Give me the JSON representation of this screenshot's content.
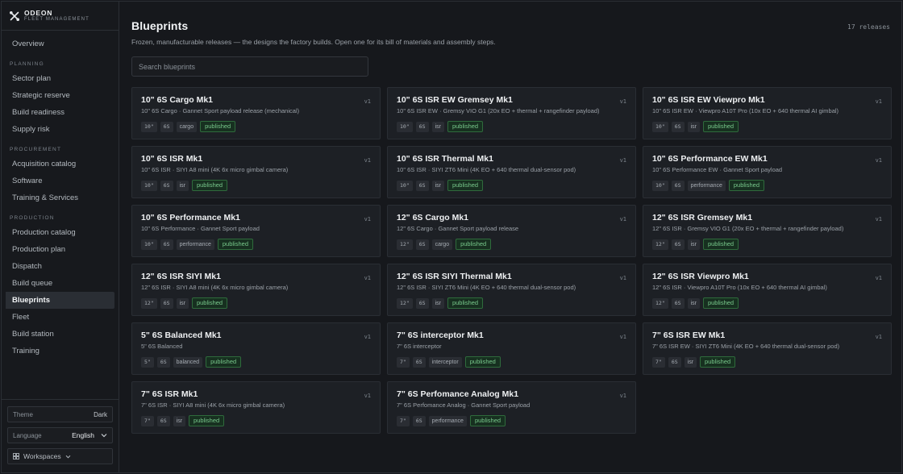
{
  "brand": {
    "name": "ODEON",
    "subtitle": "FLEET MANAGEMENT",
    "logo_icon": "crossed-tools-icon"
  },
  "sidebar": {
    "top_items": [
      {
        "label": "Overview"
      }
    ],
    "sections": [
      {
        "title": "PLANNING",
        "items": [
          {
            "label": "Sector plan"
          },
          {
            "label": "Strategic reserve"
          },
          {
            "label": "Build readiness"
          },
          {
            "label": "Supply risk"
          }
        ]
      },
      {
        "title": "PROCUREMENT",
        "items": [
          {
            "label": "Acquisition catalog"
          },
          {
            "label": "Software"
          },
          {
            "label": "Training & Services"
          }
        ]
      },
      {
        "title": "PRODUCTION",
        "items": [
          {
            "label": "Production catalog"
          },
          {
            "label": "Production plan"
          },
          {
            "label": "Dispatch"
          },
          {
            "label": "Build queue"
          },
          {
            "label": "Blueprints",
            "active": true
          },
          {
            "label": "Fleet"
          },
          {
            "label": "Build station"
          },
          {
            "label": "Training"
          }
        ]
      }
    ],
    "theme": {
      "label": "Theme",
      "value": "Dark"
    },
    "language": {
      "label": "Language",
      "value": "English"
    },
    "workspaces": {
      "label": "Workspaces",
      "icon": "grid-icon"
    }
  },
  "header": {
    "title": "Blueprints",
    "count": "17 releases",
    "subtitle": "Frozen, manufacturable releases — the designs the factory builds. Open one for its bill of materials and assembly steps."
  },
  "search": {
    "placeholder": "Search blueprints"
  },
  "colors": {
    "accent_status": "#79c98c",
    "status_bg": "#173020",
    "background": "#16181c",
    "card": "#1d2025"
  },
  "blueprints": [
    {
      "title": "10\" 6S Cargo Mk1",
      "version": "v1",
      "description": "10\" 6S Cargo · Gannet Sport payload release (mechanical)",
      "tags": [
        "10\"",
        "6S",
        "cargo"
      ],
      "status": "published"
    },
    {
      "title": "10\" 6S ISR EW Gremsey Mk1",
      "version": "v1",
      "description": "10\" 6S ISR EW · Gremsy VIO G1 (20x EO + thermal + rangefinder payload)",
      "tags": [
        "10\"",
        "6S",
        "isr"
      ],
      "status": "published"
    },
    {
      "title": "10\" 6S ISR EW Viewpro Mk1",
      "version": "v1",
      "description": "10\" 6S ISR EW · Viewpro A10T Pro (10x EO + 640 thermal AI gimbal)",
      "tags": [
        "10\"",
        "6S",
        "isr"
      ],
      "status": "published"
    },
    {
      "title": "10\" 6S ISR Mk1",
      "version": "v1",
      "description": "10\" 6S ISR · SIYI A8 mini (4K 6x micro gimbal camera)",
      "tags": [
        "10\"",
        "6S",
        "isr"
      ],
      "status": "published"
    },
    {
      "title": "10\" 6S ISR Thermal Mk1",
      "version": "v1",
      "description": "10\" 6S ISR · SIYI ZT6 Mini (4K EO + 640 thermal dual-sensor pod)",
      "tags": [
        "10\"",
        "6S",
        "isr"
      ],
      "status": "published"
    },
    {
      "title": "10\" 6S Performance EW Mk1",
      "version": "v1",
      "description": "10\" 6S Performance EW · Gannet Sport payload",
      "tags": [
        "10\"",
        "6S",
        "performance"
      ],
      "status": "published"
    },
    {
      "title": "10\" 6S Performance Mk1",
      "version": "v1",
      "description": "10\" 6S Performance · Gannet Sport payload",
      "tags": [
        "10\"",
        "6S",
        "performance"
      ],
      "status": "published"
    },
    {
      "title": "12\" 6S Cargo Mk1",
      "version": "v1",
      "description": "12\" 6S Cargo · Gannet Sport payload release",
      "tags": [
        "12\"",
        "6S",
        "cargo"
      ],
      "status": "published"
    },
    {
      "title": "12\" 6S ISR Gremsey Mk1",
      "version": "v1",
      "description": "12\" 6S ISR · Gremsy VIO G1 (20x EO + thermal + rangefinder payload)",
      "tags": [
        "12\"",
        "6S",
        "isr"
      ],
      "status": "published"
    },
    {
      "title": "12\" 6S ISR SIYI Mk1",
      "version": "v1",
      "description": "12\" 6S ISR · SIYI A8 mini (4K 6x micro gimbal camera)",
      "tags": [
        "12\"",
        "6S",
        "isr"
      ],
      "status": "published"
    },
    {
      "title": "12\" 6S ISR SIYI Thermal Mk1",
      "version": "v1",
      "description": "12\" 6S ISR · SIYI ZT6 Mini (4K EO + 640 thermal dual-sensor pod)",
      "tags": [
        "12\"",
        "6S",
        "isr"
      ],
      "status": "published"
    },
    {
      "title": "12\" 6S ISR Viewpro Mk1",
      "version": "v1",
      "description": "12\" 6S ISR · Viewpro A10T Pro (10x EO + 640 thermal AI gimbal)",
      "tags": [
        "12\"",
        "6S",
        "isr"
      ],
      "status": "published"
    },
    {
      "title": "5\" 6S Balanced Mk1",
      "version": "v1",
      "description": "5\" 6S Balanced",
      "tags": [
        "5\"",
        "6S",
        "balanced"
      ],
      "status": "published"
    },
    {
      "title": "7\" 6S interceptor Mk1",
      "version": "v1",
      "description": "7\" 6S interceptor",
      "tags": [
        "7\"",
        "6S",
        "interceptor"
      ],
      "status": "published"
    },
    {
      "title": "7\" 6S ISR EW Mk1",
      "version": "v1",
      "description": "7\" 6S ISR EW · SIYI ZT6 Mini (4K EO + 640 thermal dual-sensor pod)",
      "tags": [
        "7\"",
        "6S",
        "isr"
      ],
      "status": "published"
    },
    {
      "title": "7\" 6S ISR Mk1",
      "version": "v1",
      "description": "7\" 6S ISR · SIYI A8 mini (4K 6x micro gimbal camera)",
      "tags": [
        "7\"",
        "6S",
        "isr"
      ],
      "status": "published"
    },
    {
      "title": "7\" 6S Perfomance Analog Mk1",
      "version": "v1",
      "description": "7\" 6S Perfomance Analog · Gannet Sport payload",
      "tags": [
        "7\"",
        "6S",
        "performance"
      ],
      "status": "published"
    }
  ]
}
